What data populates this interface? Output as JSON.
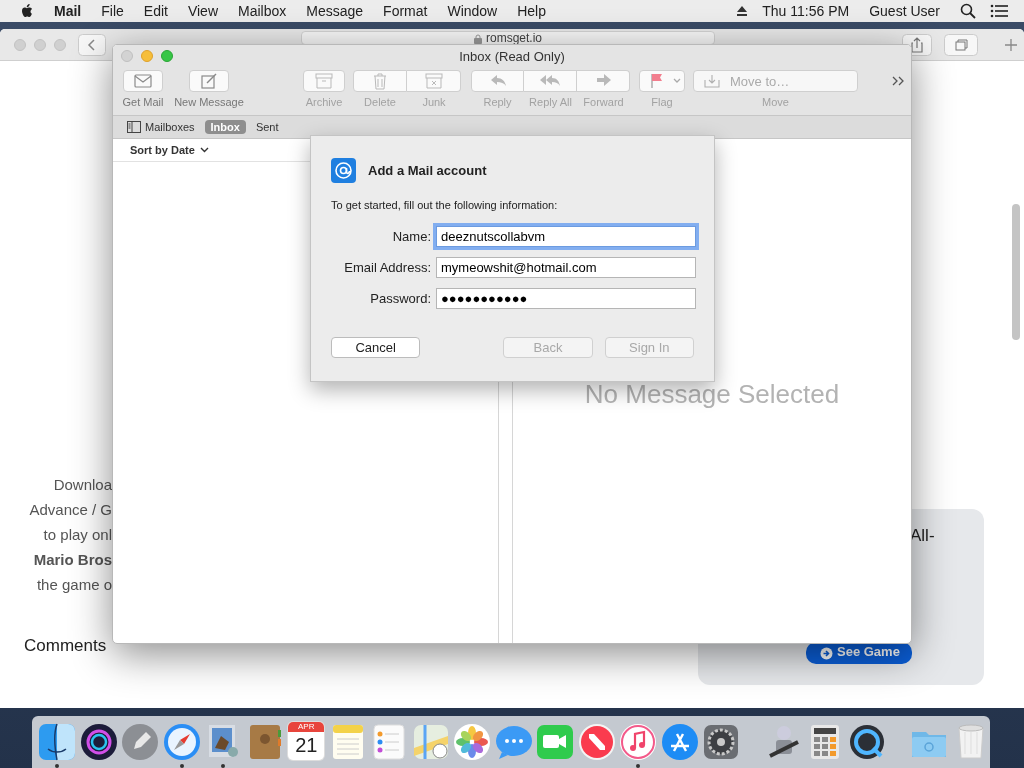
{
  "menu_bar": {
    "app": "Mail",
    "menus": [
      "File",
      "Edit",
      "View",
      "Mailbox",
      "Message",
      "Format",
      "Window",
      "Help"
    ],
    "clock": "Thu 11:56 PM",
    "user": "Guest User"
  },
  "browser": {
    "address": "romsget.io",
    "page": {
      "intro_lines": [
        {
          "text": "Downloa",
          "bold": false
        },
        {
          "text": "Advance / G",
          "bold": false
        },
        {
          "text": "to play onl",
          "bold": false
        },
        {
          "text": "Mario Bros",
          "bold": true
        },
        {
          "text": "the game o",
          "bold": false
        }
      ],
      "heading": "Comments",
      "card_text": "All-",
      "card_button": "See Game"
    }
  },
  "mail": {
    "title": "Inbox (Read Only)",
    "toolbar": [
      {
        "label": "Get Mail",
        "disabled": false
      },
      {
        "label": "New Message",
        "disabled": false
      },
      {
        "label": "Archive",
        "disabled": true
      },
      {
        "label": "Delete",
        "disabled": true
      },
      {
        "label": "Junk",
        "disabled": true
      },
      {
        "label": "Reply",
        "disabled": true
      },
      {
        "label": "Reply All",
        "disabled": true
      },
      {
        "label": "Forward",
        "disabled": true
      },
      {
        "label": "Flag",
        "disabled": true
      }
    ],
    "move": {
      "value": "Move to…",
      "label": "Move",
      "disabled": true
    },
    "favorites": [
      {
        "label": "Mailboxes",
        "selected": false
      },
      {
        "label": "Inbox",
        "selected": true
      },
      {
        "label": "Sent",
        "selected": false
      }
    ],
    "sort": "Sort by Date",
    "empty_message": "No Message Selected"
  },
  "dialog": {
    "title": "Add a Mail account",
    "intro": "To get started, fill out the following information:",
    "fields": [
      {
        "label": "Name:",
        "value": "deeznutscollabvm",
        "focused": true
      },
      {
        "label": "Email Address:",
        "value": "mymeowshit@hotmail.com",
        "focused": false
      },
      {
        "label": "Password:",
        "value": "●●●●●●●●●●●",
        "focused": false
      }
    ],
    "buttons": [
      {
        "label": "Cancel",
        "disabled": false
      },
      {
        "label": "Back",
        "disabled": true
      },
      {
        "label": "Sign In",
        "disabled": true
      }
    ]
  },
  "dock": [
    {
      "kind": "app",
      "running": true
    },
    {
      "kind": "app",
      "running": false
    },
    {
      "kind": "app",
      "running": false
    },
    {
      "kind": "app",
      "running": true
    },
    {
      "kind": "app",
      "running": true
    },
    {
      "kind": "app",
      "running": false
    },
    {
      "kind": "calendar",
      "month": "APR",
      "day": "21",
      "running": false
    },
    {
      "kind": "app",
      "running": false
    },
    {
      "kind": "app",
      "running": false
    },
    {
      "kind": "app",
      "running": false
    },
    {
      "kind": "app",
      "running": false
    },
    {
      "kind": "app",
      "running": false
    },
    {
      "kind": "app",
      "running": false
    },
    {
      "kind": "app",
      "running": false
    },
    {
      "kind": "app",
      "running": true
    },
    {
      "kind": "app",
      "running": false
    },
    {
      "kind": "app",
      "running": false
    },
    {
      "kind": "separator"
    },
    {
      "kind": "app",
      "running": false
    },
    {
      "kind": "app",
      "running": false
    },
    {
      "kind": "app",
      "running": false
    },
    {
      "kind": "separator"
    },
    {
      "kind": "app",
      "running": false
    },
    {
      "kind": "app",
      "running": false
    }
  ]
}
